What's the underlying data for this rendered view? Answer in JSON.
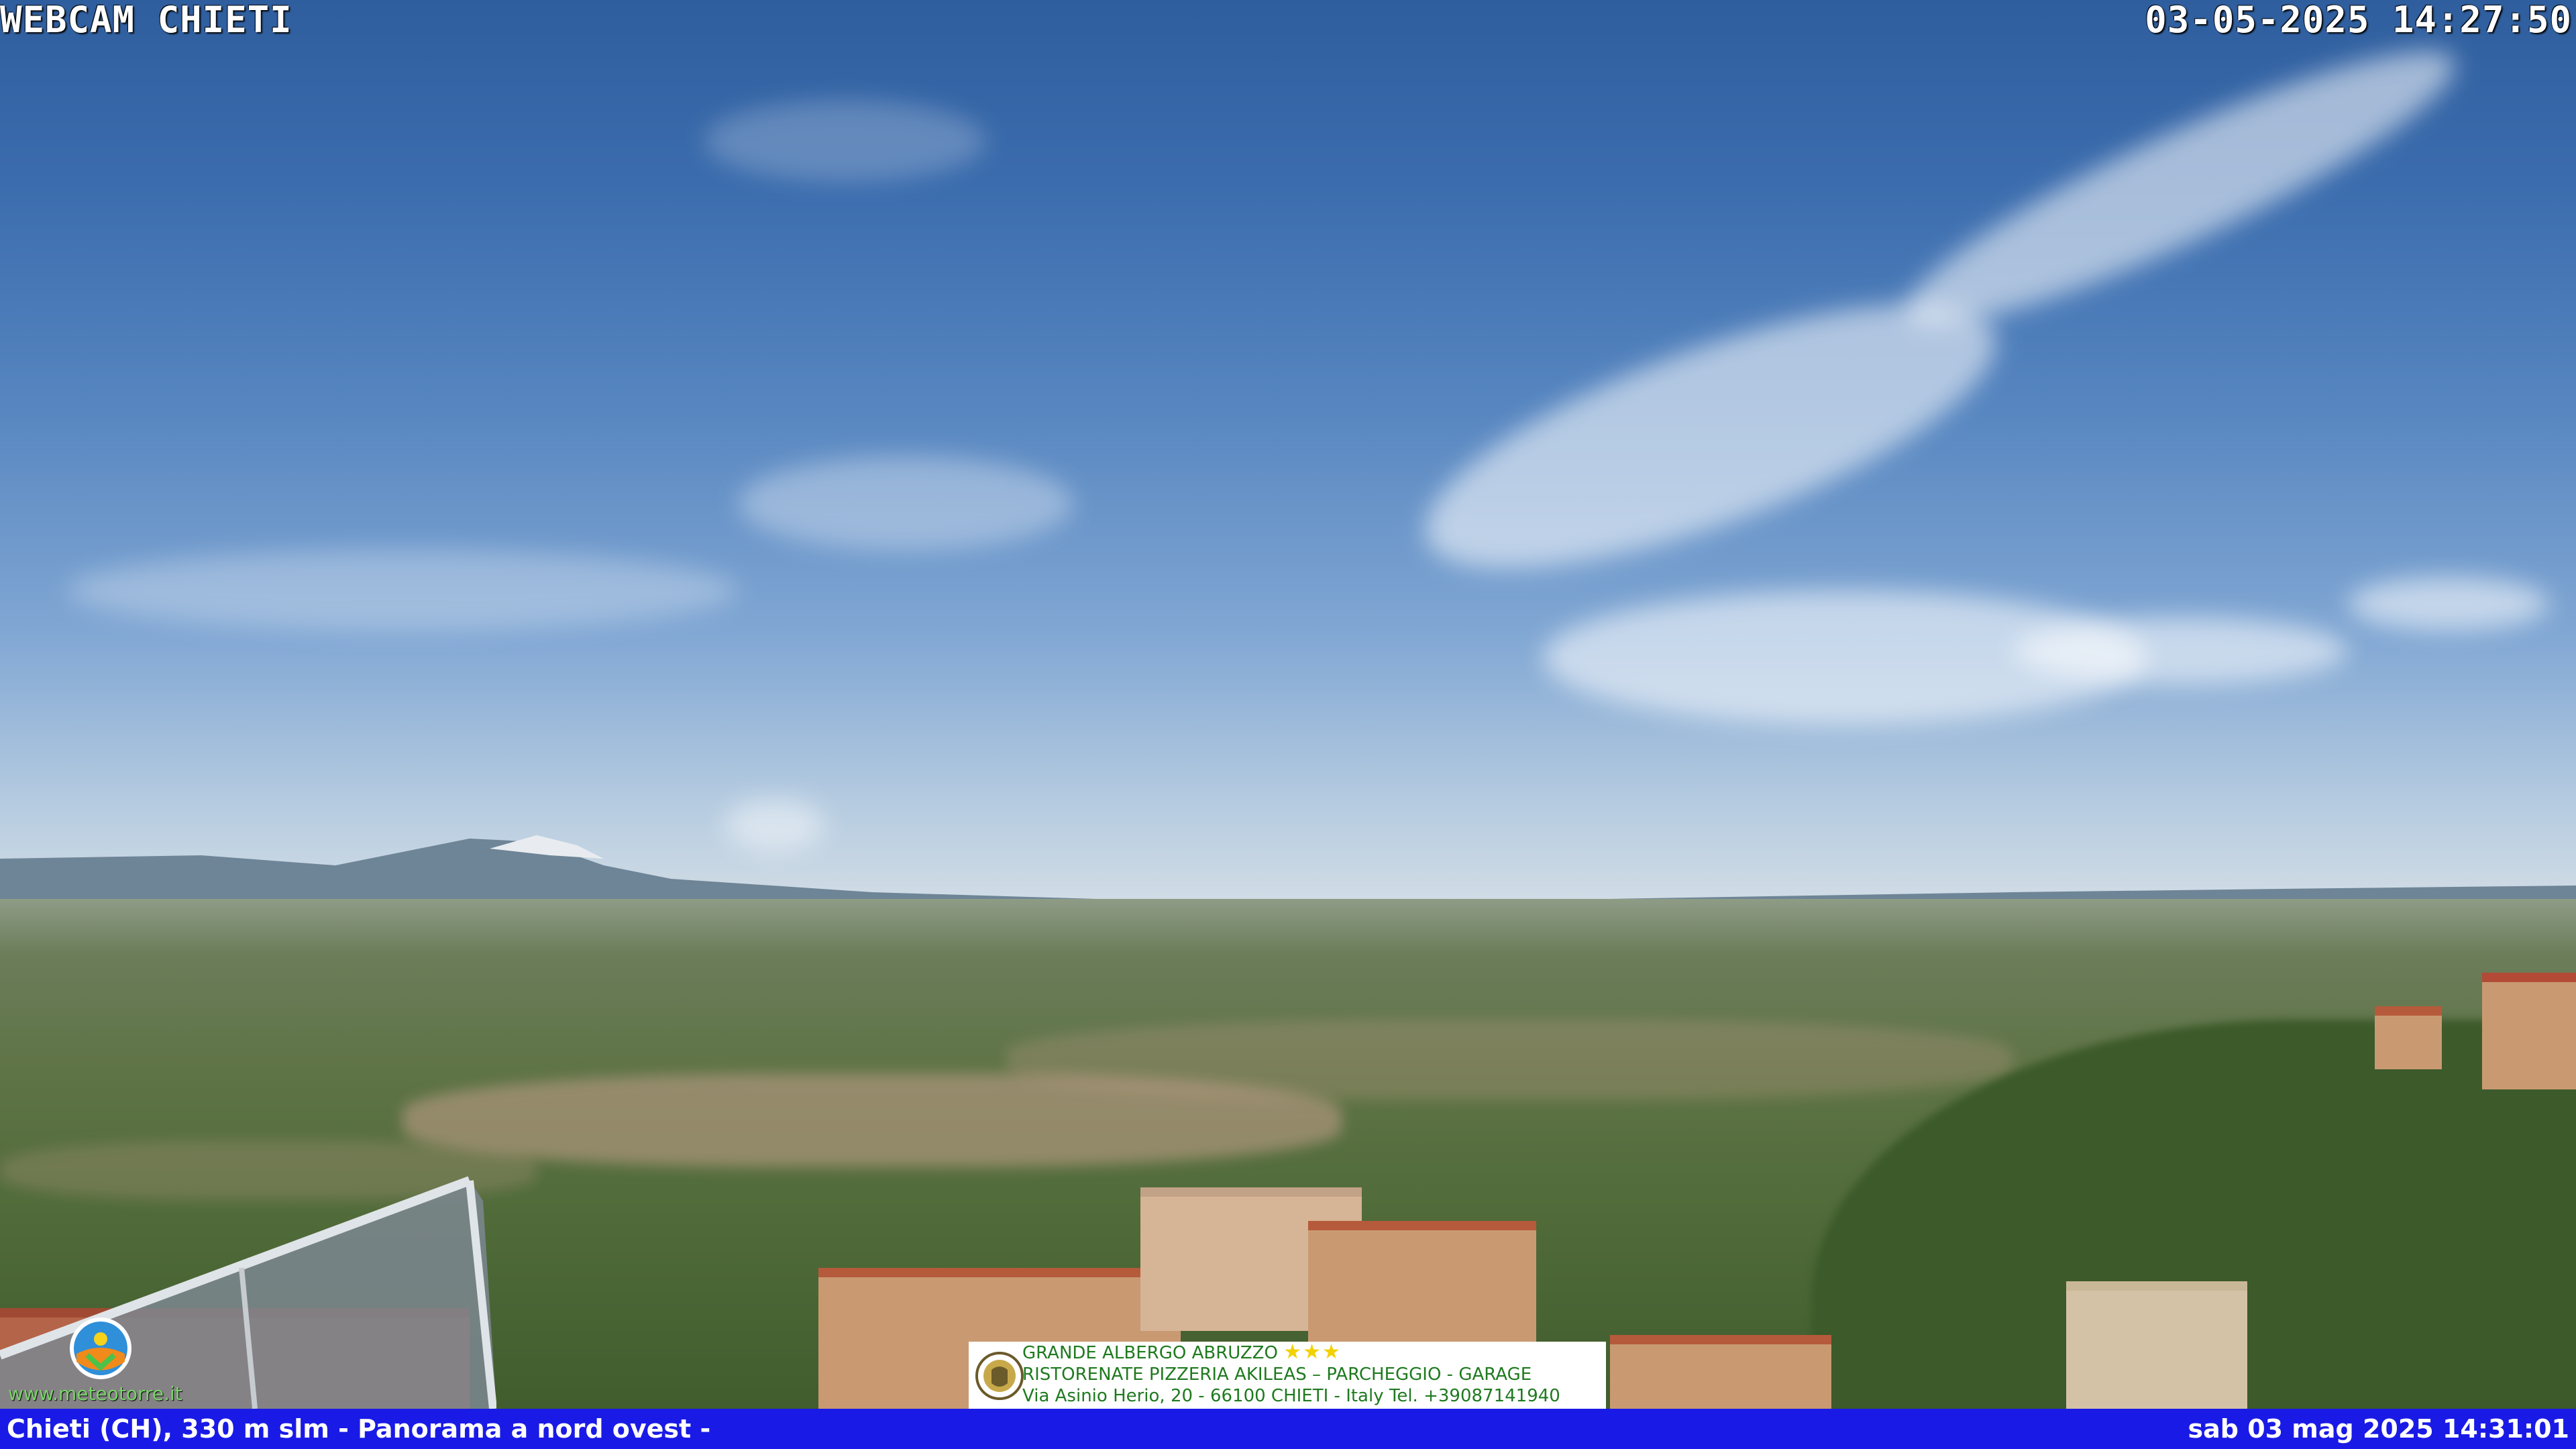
{
  "overlay": {
    "title": "WEBCAM CHIETI",
    "timestamp": "03-05-2025 14:27:50"
  },
  "footer": {
    "caption": "Chieti (CH), 330 m slm - Panorama a nord ovest -",
    "datetime": "sab 03 mag 2025 14:31:01",
    "bar_color": "#1a1ae6"
  },
  "logo": {
    "url": "www.meteotorre.it",
    "icon": "weather-station-logo"
  },
  "ad": {
    "line1": "GRANDE ALBERGO ABRUZZO",
    "stars": "★★★",
    "line2": "RISTORENATE PIZZERIA AKILEAS – PARCHEGGIO - GARAGE",
    "line3": "Via Asinio Herio, 20 - 66100 CHIETI - Italy Tel. +39087141940",
    "seal_icon": "crest-seal"
  }
}
